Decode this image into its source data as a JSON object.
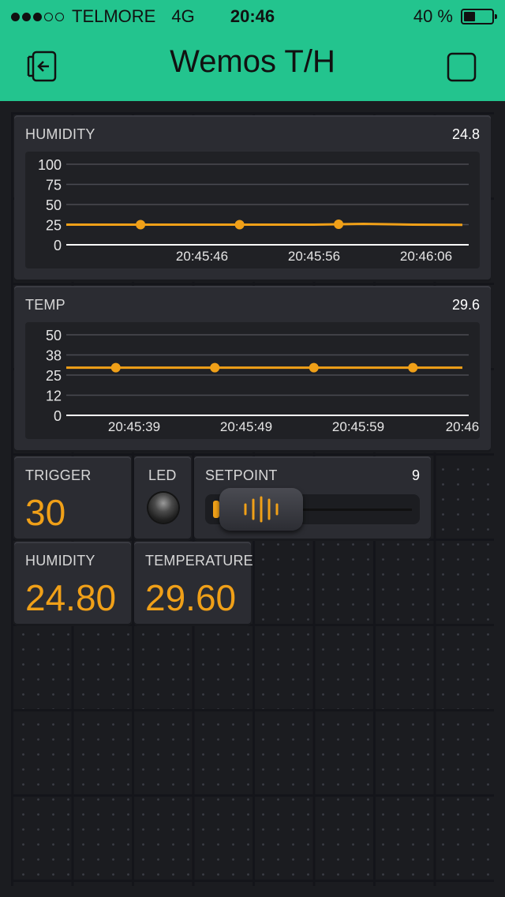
{
  "status_bar": {
    "carrier": "TELMORE",
    "network": "4G",
    "time": "20:46",
    "battery_percent": "40 %",
    "battery_level": 0.4,
    "signal_bars_filled": 3,
    "signal_bars_total": 5
  },
  "header": {
    "title": "Wemos T/H",
    "left_icon": "exit-icon",
    "right_icon": "square-icon"
  },
  "colors": {
    "accent": "#23c48e",
    "value": "#f0a018",
    "background": "#1b1c20",
    "widget": "#2b2c32"
  },
  "humidity_chart": {
    "label": "HUMIDITY",
    "value": "24.8",
    "chart_data": {
      "type": "line",
      "title": "HUMIDITY",
      "y_ticks": [
        "100",
        "75",
        "50",
        "25",
        "0"
      ],
      "x_ticks": [
        "20:45:46",
        "20:45:56",
        "20:46:06"
      ],
      "ylim": [
        0,
        100
      ],
      "series": [
        {
          "color": "#f0a018",
          "x": [
            0,
            1,
            2,
            3,
            4,
            5,
            6,
            7,
            8
          ],
          "values": [
            25,
            25,
            25,
            25,
            25,
            25,
            26,
            25,
            24.8
          ],
          "markers_at": [
            1.5,
            3.5,
            5.5
          ]
        }
      ]
    }
  },
  "temp_chart": {
    "label": "TEMP",
    "value": "29.6",
    "chart_data": {
      "type": "line",
      "title": "TEMP",
      "y_ticks": [
        "50",
        "38",
        "25",
        "12",
        "0"
      ],
      "x_ticks": [
        "20:45:39",
        "20:45:49",
        "20:45:59",
        "20:46"
      ],
      "ylim": [
        0,
        50
      ],
      "series": [
        {
          "color": "#f0a018",
          "x": [
            0,
            1,
            2,
            3,
            4,
            5,
            6,
            7,
            8
          ],
          "values": [
            29.6,
            29.6,
            29.6,
            29.6,
            29.6,
            29.6,
            29.6,
            29.6,
            29.6
          ],
          "markers_at": [
            1,
            3,
            5,
            7
          ]
        }
      ]
    }
  },
  "trigger": {
    "label": "TRIGGER",
    "value": "30"
  },
  "led": {
    "label": "LED"
  },
  "setpoint": {
    "label": "SETPOINT",
    "value": "9",
    "fraction": 0.0
  },
  "humidity_display": {
    "label": "HUMIDITY",
    "value": "24.80"
  },
  "temperature_display": {
    "label": "TEMPERATURE",
    "value": "29.60"
  }
}
